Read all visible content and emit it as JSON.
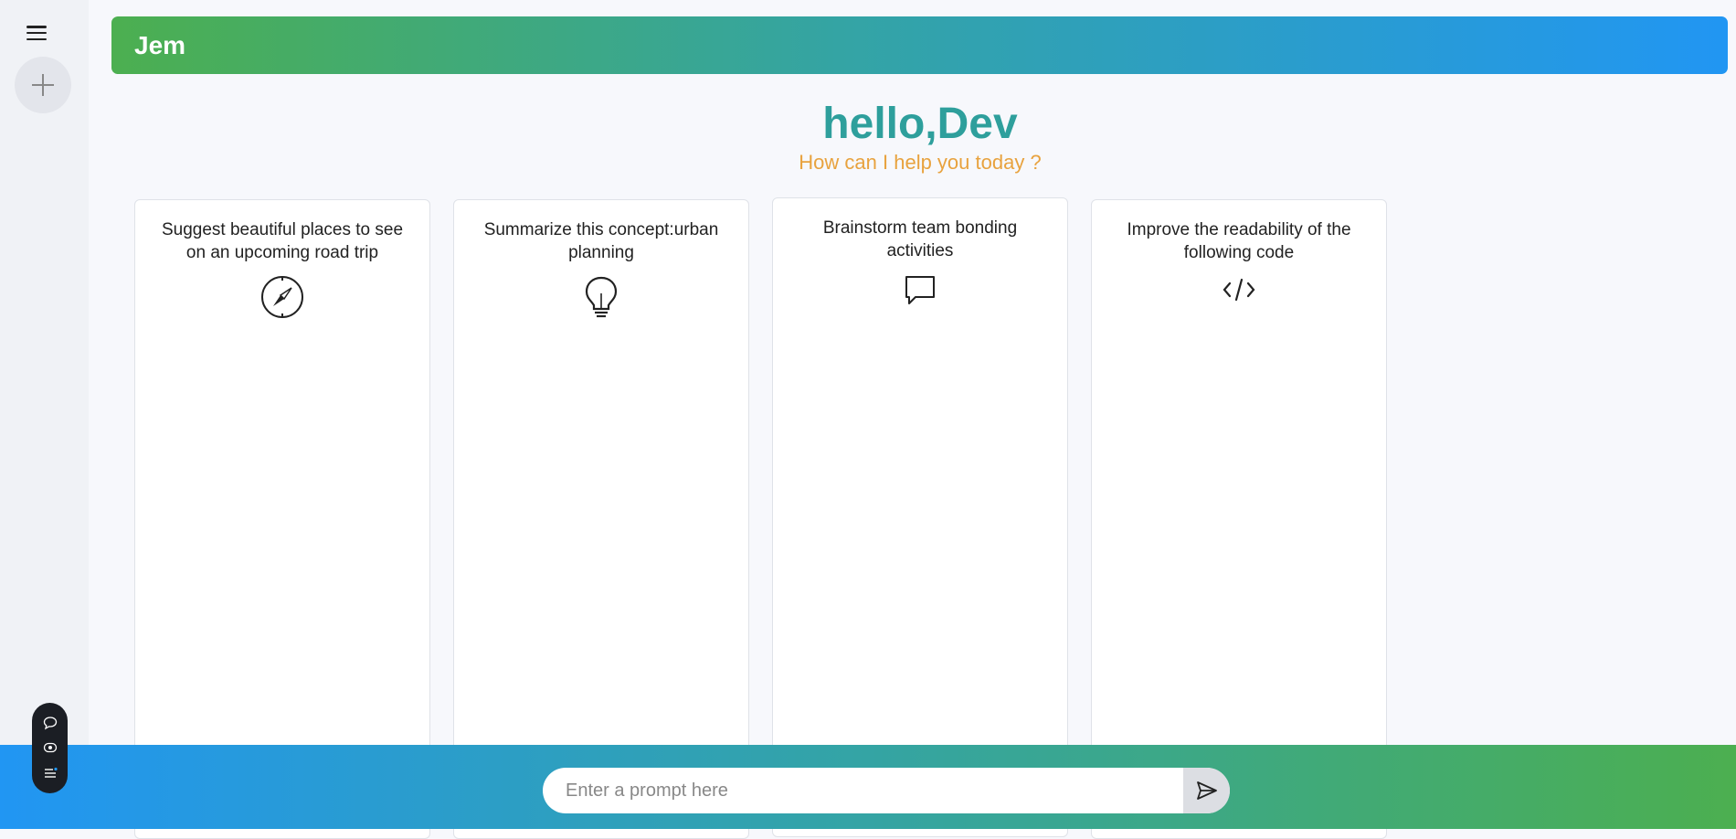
{
  "app": {
    "brand": "Jem"
  },
  "sidebar": {
    "menu_icon": "hamburger-menu-icon",
    "new_chat_icon": "plus-icon"
  },
  "greeting": {
    "title": "hello,Dev",
    "subtitle": "How can I help you today ?"
  },
  "cards": [
    {
      "text": "Suggest beautiful places to see on an upcoming road trip",
      "icon": "compass-icon"
    },
    {
      "text": "Summarize this concept:urban planning",
      "icon": "lightbulb-icon"
    },
    {
      "text": "Brainstorm team bonding activities",
      "icon": "message-icon"
    },
    {
      "text": "Improve the readability of the following code",
      "icon": "code-icon"
    }
  ],
  "prompt": {
    "placeholder": "Enter a prompt here",
    "value": "",
    "send_icon": "send-icon"
  },
  "toolbar": {
    "icons": [
      "chat-bubble-icon",
      "eye-icon",
      "list-settings-icon"
    ]
  },
  "colors": {
    "accent_green": "#4caf50",
    "accent_blue": "#2196f3",
    "greeting_teal": "#2e9f9c",
    "subtitle_orange": "#e8a23e"
  }
}
